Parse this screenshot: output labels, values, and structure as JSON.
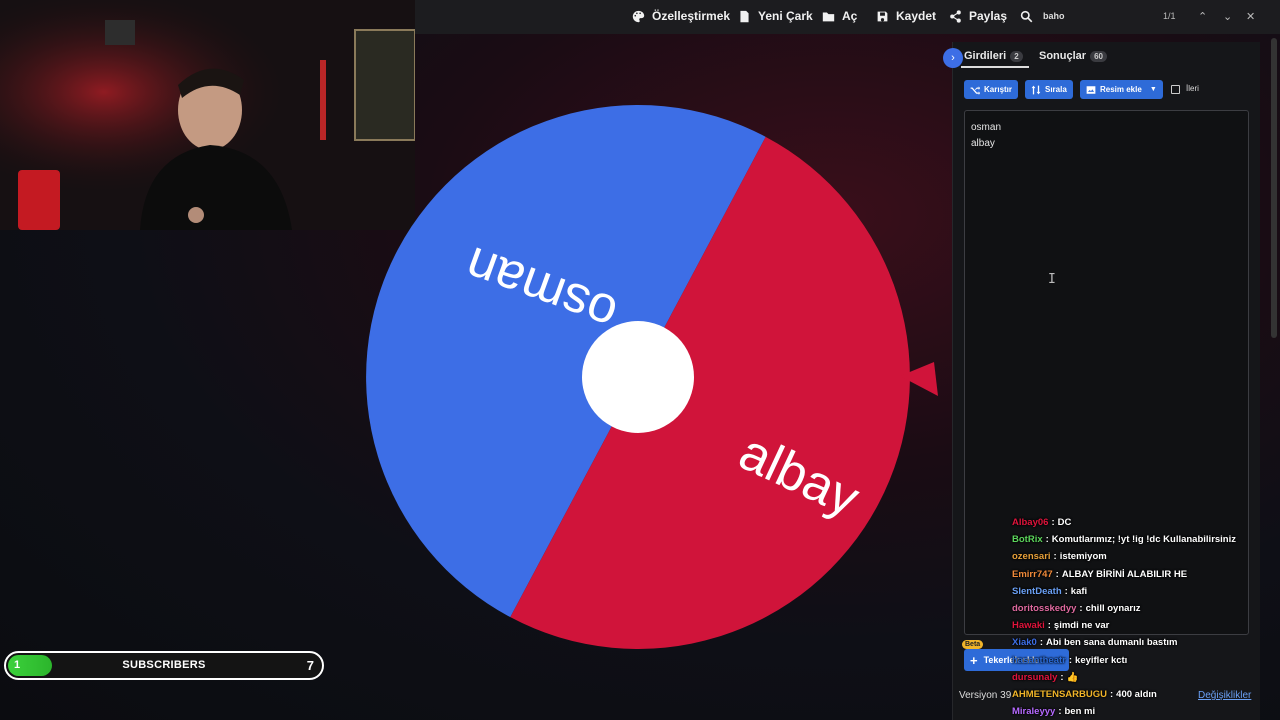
{
  "toolbar": {
    "customize_label": "Özelleştirmek",
    "new_wheel_label": "Yeni Çark",
    "open_label": "Aç",
    "save_label": "Kaydet",
    "share_label": "Paylaş"
  },
  "find": {
    "query": "baho",
    "count": "1/1"
  },
  "wheel": {
    "segments": [
      {
        "label": "osman",
        "color": "#3d6ee6"
      },
      {
        "label": "albay",
        "color": "#d0143a"
      }
    ],
    "hub_color": "#ffffff",
    "pointer_color": "#d0143a"
  },
  "panel": {
    "tab_entries": {
      "label": "Girdileri",
      "count": "2"
    },
    "tab_results": {
      "label": "Sonuçlar",
      "count": "60"
    },
    "shuffle_label": "Karıştır",
    "sort_label": "Sırala",
    "add_image_label": "Resim ekle",
    "advanced_label": "İleri",
    "entries_text": [
      "osman",
      "albay"
    ],
    "beta_label": "Beta",
    "add_wheel_label": "Tekerlek ekle",
    "version_label": "Versiyon 39",
    "changes_link": "Değişiklikler"
  },
  "chat": [
    {
      "user": "Albay06",
      "color": "#e0143c",
      "msg": "DC"
    },
    {
      "user": "BotRix",
      "color": "#5cd65c",
      "msg": "Komutlarımız; !yt !ig !dc Kullanabilirsiniz"
    },
    {
      "user": "ozensari",
      "color": "#e8a13a",
      "msg": "istemiyom"
    },
    {
      "user": "Emirr747",
      "color": "#f08a3a",
      "msg": "ALBAY BİRİNİ ALABILIR HE"
    },
    {
      "user": "SlentDeath",
      "color": "#6aa0f5",
      "msg": "kafi"
    },
    {
      "user": "doritosskedyy",
      "color": "#e06aa0",
      "msg": "chill oynarız"
    },
    {
      "user": "Hawaki",
      "color": "#e0143c",
      "msg": "şimdi ne var"
    },
    {
      "user": "Xiak0",
      "color": "#3d6ee6",
      "msg": "Abi ben sana dumanlı bastım"
    },
    {
      "user": "hasantheatr",
      "color": "#2a6bd8",
      "msg": "keyifler kctı"
    },
    {
      "user": "dursunaly",
      "color": "#e0143c",
      "msg": "👍"
    },
    {
      "user": "AHMETENSARBUGU",
      "color": "#f0b429",
      "msg": "400 aldın"
    },
    {
      "user": "Miraleyyy",
      "color": "#b56aff",
      "msg": "ben mi"
    }
  ],
  "subscribers": {
    "label": "SUBSCRIBERS",
    "current": "1",
    "goal": "7",
    "progress": 0.14
  }
}
